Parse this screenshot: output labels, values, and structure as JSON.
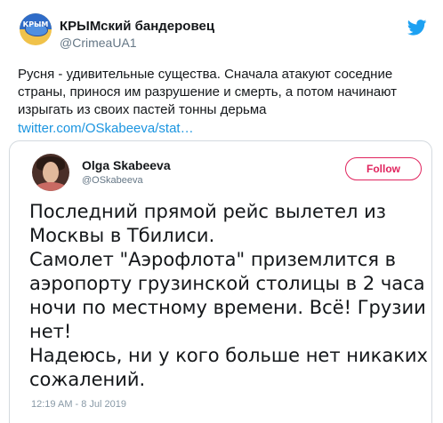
{
  "tweet": {
    "author_name": "КРЫМский бандеровец",
    "author_handle": "@CrimeaUA1",
    "avatar_text": "КРЫМ",
    "text": "Русня - удивительные существа. Сначала атакуют соседние страны, принося им разрушение и смерть, а потом начинают изрыгать из своих пастей тонны дерьма",
    "link": "twitter.com/OSkabeeva/stat…"
  },
  "quoted": {
    "author_name": "Olga Skabeeva",
    "author_handle": "@OSkabeeva",
    "follow_label": "Follow",
    "lines": [
      "Последний прямой рейс вылетел из",
      "Москвы в Тбилиси.",
      "Самолет \"Аэрофлота\" приземлится в",
      "аэропорту грузинской столицы в 2 часа",
      "ночи по местному времени. Всё! Грузии",
      "нет!",
      "Надеюсь, ни у кого больше нет никаких",
      "сожалений."
    ],
    "timestamp": "12:19 AM - 8 Jul 2019"
  },
  "colors": {
    "twitter_blue": "#1da1f2",
    "link": "#1b95e0",
    "follow_accent": "#e0245e"
  },
  "icons": {
    "brand": "twitter-bird-icon"
  }
}
